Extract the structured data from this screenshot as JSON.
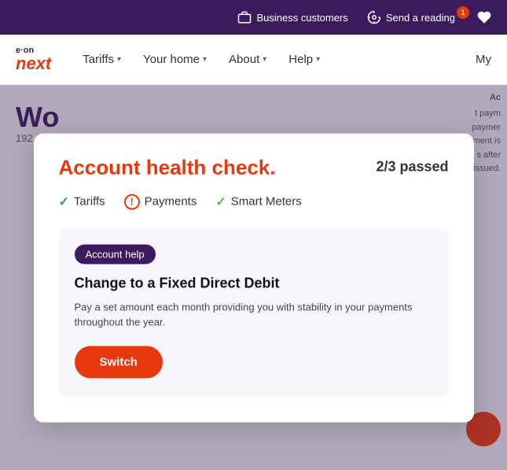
{
  "topbar": {
    "business_label": "Business customers",
    "send_reading_label": "Send a reading",
    "notification_count": "1"
  },
  "nav": {
    "logo_eon": "e·on",
    "logo_next": "next",
    "tariffs_label": "Tariffs",
    "your_home_label": "Your home",
    "about_label": "About",
    "help_label": "Help",
    "my_label": "My"
  },
  "modal": {
    "title": "Account health check.",
    "passed_label": "2/3 passed",
    "checks": [
      {
        "name": "Tariffs",
        "status": "pass"
      },
      {
        "name": "Payments",
        "status": "warn"
      },
      {
        "name": "Smart Meters",
        "status": "pass"
      }
    ],
    "badge_label": "Account help",
    "card_heading": "Change to a Fixed Direct Debit",
    "card_desc": "Pay a set amount each month providing you with stability in your payments throughout the year.",
    "switch_label": "Switch"
  },
  "right_panel": {
    "label": "Ac",
    "body": "t paym\npaymer\nment is\ns after\nissued."
  }
}
